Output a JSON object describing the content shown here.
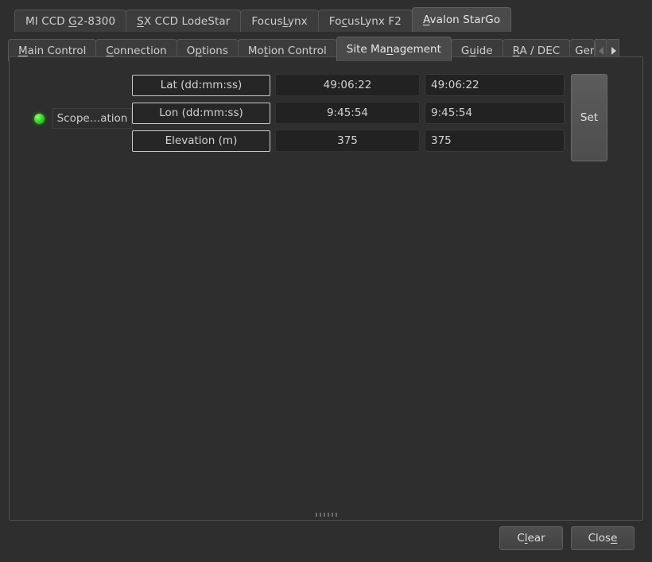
{
  "device_tabs": [
    {
      "label": "MI CCD G2-8300",
      "mnemonic": "G",
      "active": false
    },
    {
      "label": "SX CCD LodeStar",
      "mnemonic": "S",
      "active": false
    },
    {
      "label": "FocusLynx",
      "mnemonic": "L",
      "active": false
    },
    {
      "label": "FocusLynx F2",
      "mnemonic": "c",
      "active": false
    },
    {
      "label": "Avalon StarGo",
      "mnemonic": "A",
      "active": true
    }
  ],
  "function_tabs": [
    {
      "label": "Main Control",
      "mnemonic": "M",
      "active": false
    },
    {
      "label": "Connection",
      "mnemonic": "C",
      "active": false
    },
    {
      "label": "Options",
      "mnemonic": "p",
      "active": false
    },
    {
      "label": "Motion Control",
      "mnemonic": "t",
      "active": false
    },
    {
      "label": "Site Management",
      "mnemonic": "n",
      "active": true
    },
    {
      "label": "Guide",
      "mnemonic": "u",
      "active": false
    },
    {
      "label": "RA / DEC",
      "mnemonic": "R",
      "active": false
    },
    {
      "label": "Ger",
      "mnemonic": "",
      "active": false
    }
  ],
  "tab_scroll": {
    "left_arrow": "scroll-left-arrow",
    "right_arrow": "scroll-right-arrow"
  },
  "site_management": {
    "status_led": {
      "name": "connection-led",
      "color": "#2ad018",
      "state": "on"
    },
    "scope_label": "Scope…ation",
    "set_button": "Set",
    "rows": [
      {
        "label": "Lat (dd:mm:ss)",
        "current": "49:06:22",
        "input": "49:06:22"
      },
      {
        "label": "Lon (dd:mm:ss)",
        "current": "9:45:54",
        "input": "9:45:54"
      },
      {
        "label": "Elevation (m)",
        "current": "375",
        "input": "375"
      }
    ]
  },
  "footer": {
    "clear_label": "Clear",
    "clear_mnemonic": "l",
    "close_label": "Close",
    "close_mnemonic": "e"
  }
}
